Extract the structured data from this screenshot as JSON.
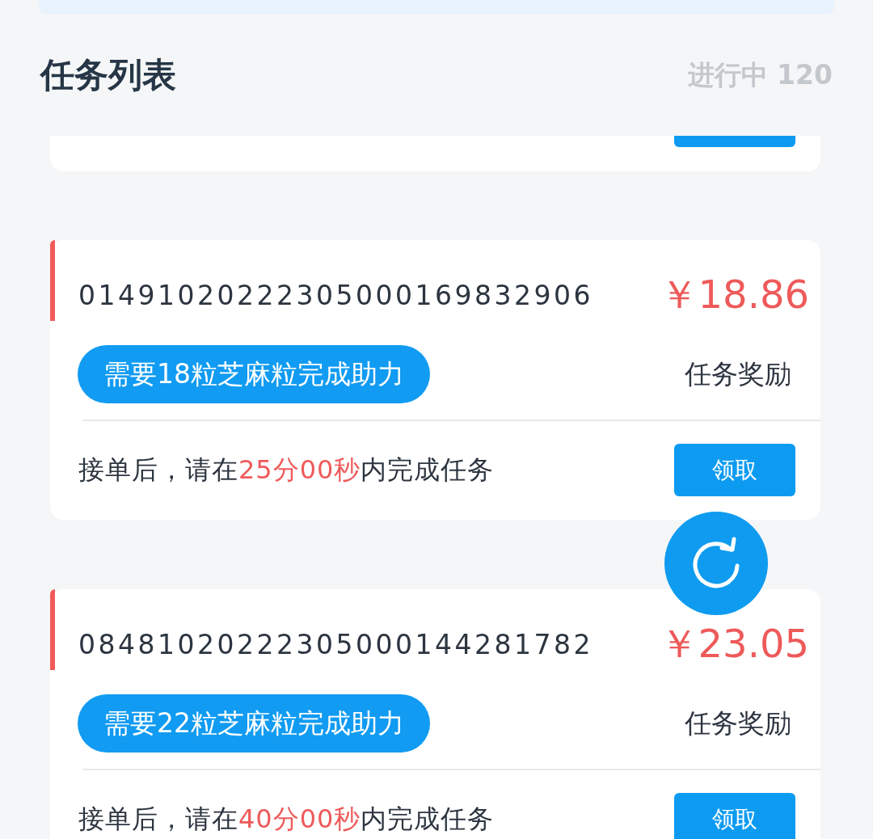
{
  "header": {
    "title": "任务列表",
    "status": "进行中 120"
  },
  "tasks": [
    {
      "kind": "partial"
    },
    {
      "kind": "full",
      "id": "01491020222305000169832906",
      "price": "￥18.86",
      "requirement": "需要18粒芝麻粒完成助力",
      "reward_label": "任务奖励",
      "deadline_prefix": "接单后，请在",
      "deadline_time": "25分00秒",
      "deadline_suffix": "内完成任务",
      "button": "领取"
    },
    {
      "kind": "full",
      "id": "08481020222305000144281782",
      "price": "￥23.05",
      "requirement": "需要22粒芝麻粒完成助力",
      "reward_label": "任务奖励",
      "deadline_prefix": "接单后，请在",
      "deadline_time": "40分00秒",
      "deadline_suffix": "内完成任务",
      "button": "领取"
    }
  ]
}
